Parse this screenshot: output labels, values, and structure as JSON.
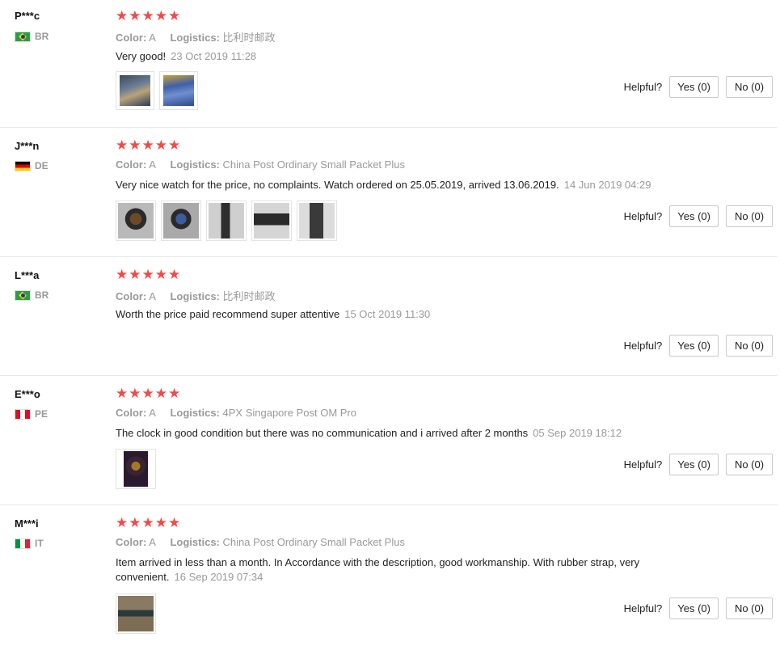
{
  "labels": {
    "color": "Color:",
    "logistics": "Logistics:",
    "helpful": "Helpful?",
    "stars": "★★★★★"
  },
  "colors": {
    "star": "#f24a4a",
    "muted": "#999999"
  },
  "reviews": [
    {
      "user": "P***c",
      "country": "BR",
      "flag": "brazil-flag-icon",
      "rating": 5,
      "color_value": "A",
      "logistics_value": "比利时邮政",
      "comment": "Very good!",
      "date": "23 Oct 2019 11:28",
      "yes": "Yes (0)",
      "no": "No (0)",
      "photos": 2
    },
    {
      "user": "J***n",
      "country": "DE",
      "flag": "germany-flag-icon",
      "rating": 5,
      "color_value": "A",
      "logistics_value": "China Post Ordinary Small Packet Plus",
      "comment": "Very nice watch for the price, no complaints. Watch ordered on 25.05.2019, arrived 13.06.2019.",
      "date": "14 Jun 2019 04:29",
      "yes": "Yes (0)",
      "no": "No (0)",
      "photos": 5
    },
    {
      "user": "L***a",
      "country": "BR",
      "flag": "brazil-flag-icon",
      "rating": 5,
      "color_value": "A",
      "logistics_value": "比利时邮政",
      "comment": "Worth the price paid recommend super attentive",
      "date": "15 Oct 2019 11:30",
      "yes": "Yes (0)",
      "no": "No (0)",
      "photos": 0
    },
    {
      "user": "E***o",
      "country": "PE",
      "flag": "peru-flag-icon",
      "rating": 5,
      "color_value": "A",
      "logistics_value": "4PX Singapore Post OM Pro",
      "comment": "The clock in good condition but there was no communication and i arrived after 2 months",
      "date": "05 Sep 2019 18:12",
      "yes": "Yes (0)",
      "no": "No (0)",
      "photos": 1
    },
    {
      "user": "M***i",
      "country": "IT",
      "flag": "italy-flag-icon",
      "rating": 5,
      "color_value": "A",
      "logistics_value": "China Post Ordinary Small Packet Plus",
      "comment": "Item arrived in less than a month. In Accordance with the description, good workmanship. With rubber strap, very convenient.",
      "date": "16 Sep 2019 07:34",
      "yes": "Yes (0)",
      "no": "No (0)",
      "photos": 1
    }
  ]
}
